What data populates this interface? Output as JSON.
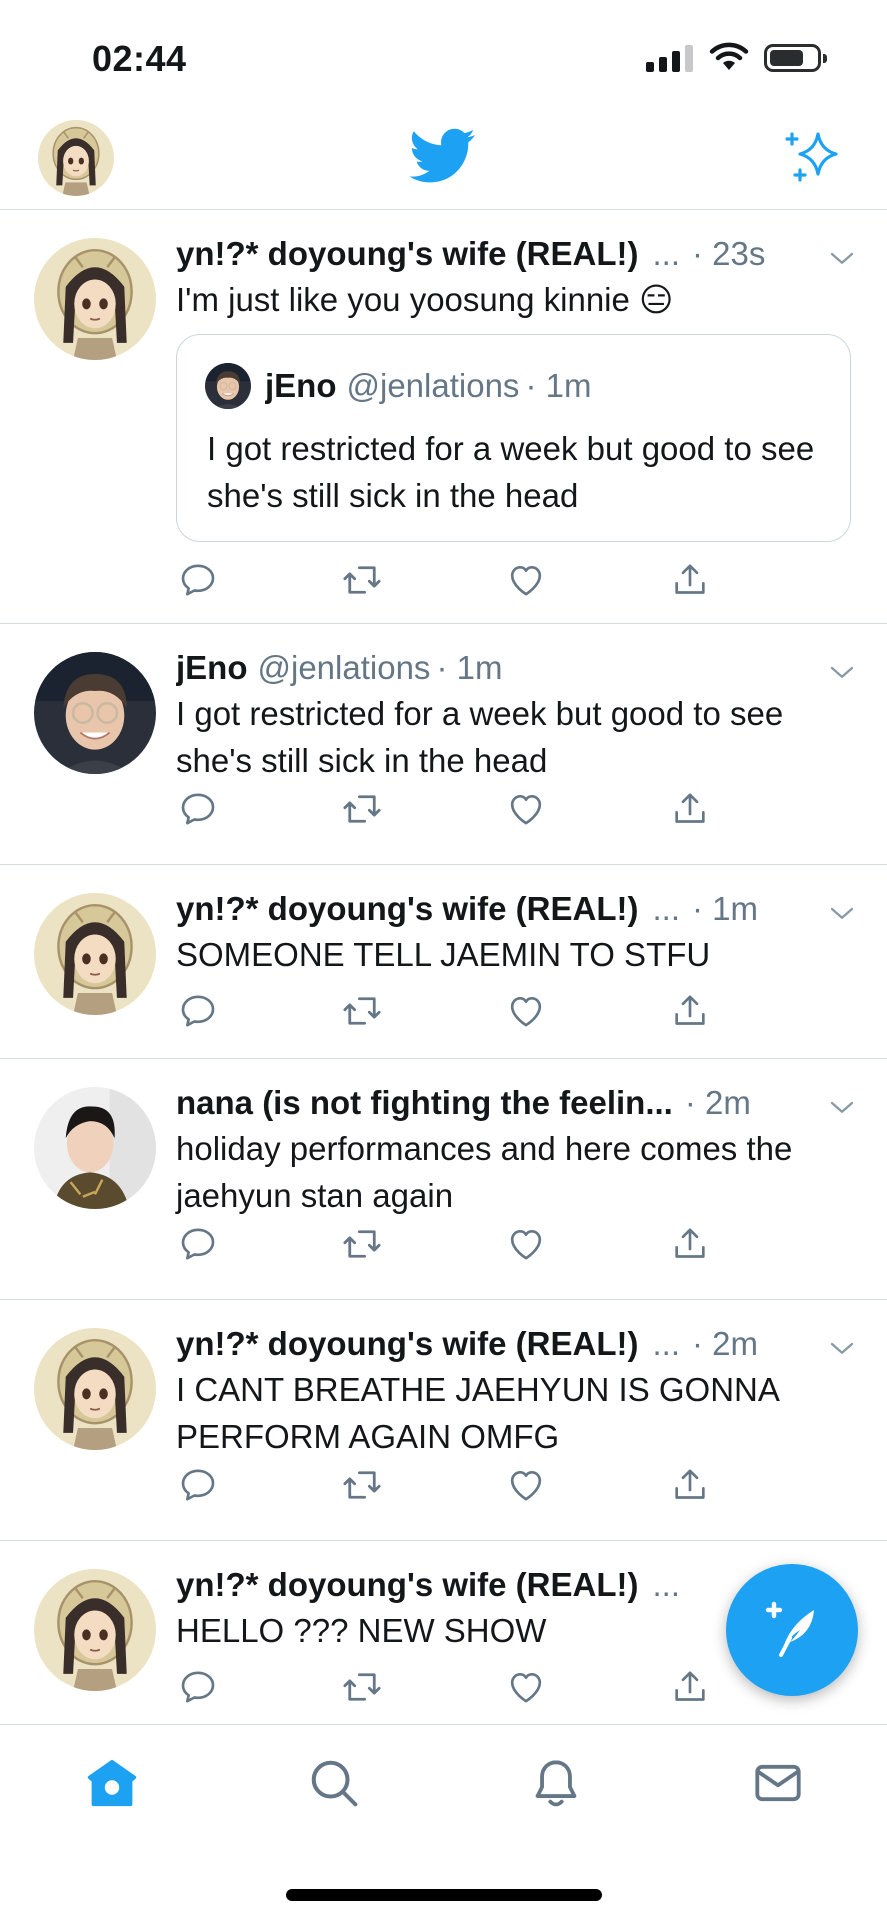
{
  "status_bar": {
    "time": "02:44"
  },
  "nav": {
    "home_icon": "twitter-bird-icon",
    "timeline_icon": "sparkle-icon"
  },
  "tweets": [
    {
      "name": "yn!?* doyoung's wife (REAL!)",
      "handle": "",
      "ellipsis": "...",
      "time": "· 23s",
      "text": "I'm just like you yoosung kinnie 😑",
      "quote": {
        "name": "jEno",
        "handle": "@jenlations",
        "time": "· 1m",
        "text": "I got restricted for a week but good to see she's still sick in the head"
      }
    },
    {
      "name": "jEno",
      "handle": "@jenlations",
      "ellipsis": "",
      "time": "· 1m",
      "text": "I got restricted for a week but good to see she's still sick in the head"
    },
    {
      "name": "yn!?* doyoung's wife (REAL!)",
      "handle": "",
      "ellipsis": "...",
      "time": "· 1m",
      "text": "SOMEONE TELL JAEMIN TO STFU"
    },
    {
      "name": "nana (is not fighting the feelin...",
      "handle": "",
      "ellipsis": "",
      "time": "· 2m",
      "text": "holiday performances and here comes the jaehyun stan again"
    },
    {
      "name": "yn!?* doyoung's wife (REAL!)",
      "handle": "",
      "ellipsis": "...",
      "time": "· 2m",
      "text": "I CANT BREATHE JAEHYUN IS GONNA PERFORM AGAIN OMFG"
    },
    {
      "name": "yn!?* doyoung's wife (REAL!)",
      "handle": "",
      "ellipsis": "...",
      "time": "",
      "text": "HELLO ??? NEW SHOW"
    }
  ],
  "tab_bar": [
    "home-icon",
    "search-icon",
    "notifications-icon",
    "messages-icon"
  ],
  "colors": {
    "accent": "#1da1f2",
    "secondary_text": "#657786",
    "divider": "#d6dce1"
  }
}
